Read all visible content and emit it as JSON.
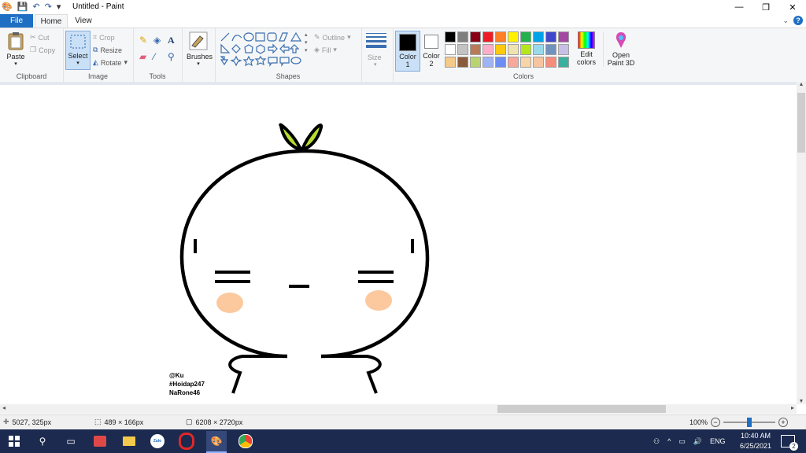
{
  "window": {
    "title": "Untitled - Paint"
  },
  "tabs": {
    "file": "File",
    "home": "Home",
    "view": "View"
  },
  "ribbon": {
    "clipboard": {
      "paste": "Paste",
      "cut": "Cut",
      "copy": "Copy",
      "label": "Clipboard"
    },
    "image": {
      "select": "Select",
      "crop": "Crop",
      "resize": "Resize",
      "rotate": "Rotate",
      "label": "Image"
    },
    "tools": {
      "label": "Tools"
    },
    "brushes": {
      "label": "Brushes"
    },
    "shapes": {
      "outline": "Outline",
      "fill": "Fill",
      "label": "Shapes"
    },
    "size": {
      "label": "Size"
    },
    "colors": {
      "color1": "Color",
      "color1_num": "1",
      "color2": "Color",
      "color2_num": "2",
      "edit": "Edit",
      "edit2": "colors",
      "label": "Colors",
      "palette": [
        "#000000",
        "#7f7f7f",
        "#880015",
        "#ed1c24",
        "#ff7f27",
        "#fff200",
        "#22b14c",
        "#00a2e8",
        "#3f48cc",
        "#a349a4",
        "#ffffff",
        "#c3c3c3",
        "#b97a57",
        "#ffaec9",
        "#ffc90e",
        "#efe4b0",
        "#b5e61d",
        "#99d9ea",
        "#7092be",
        "#c8bfe7",
        "#f5c987",
        "#8a5a3c",
        "#b9d36f",
        "#9fb3f7",
        "#6d8ef0",
        "#f7a89a",
        "#f7d5a8",
        "#f7c4a0",
        "#f58d7a",
        "#3ab09e"
      ]
    },
    "paint3d": {
      "line1": "Open",
      "line2": "Paint 3D"
    }
  },
  "drawing": {
    "signature": [
      "@Ku",
      "#Hoidap247",
      "NaRone46"
    ]
  },
  "status": {
    "cursor": "5027, 325px",
    "selection": "489 × 166px",
    "canvas_size": "6208 × 2720px",
    "zoom": "100%"
  },
  "taskbar": {
    "zalo": "Zalo",
    "lang": "ENG",
    "time": "10:40 AM",
    "date": "6/25/2021",
    "notif": "2"
  }
}
